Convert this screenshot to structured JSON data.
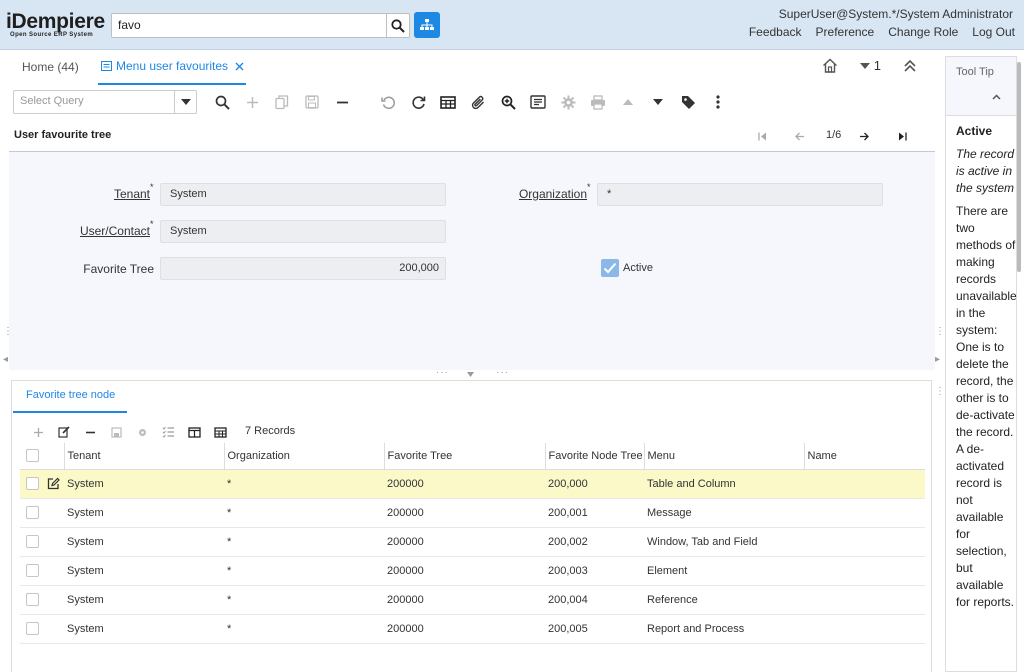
{
  "app": {
    "logo_main": "iDempiere",
    "logo_sub": "Open Source  ERP System"
  },
  "search": {
    "value": "favo"
  },
  "user": {
    "line": "SuperUser@System.*/System Administrator"
  },
  "header_links": [
    "Feedback",
    "Preference",
    "Change Role",
    "Log Out"
  ],
  "tabs": {
    "home": "Home (44)",
    "active": "Menu user favourites",
    "window_count": "1"
  },
  "toolbar": {
    "query_placeholder": "Select Query"
  },
  "record": {
    "title": "User favourite tree",
    "position": "1/6"
  },
  "form": {
    "tenant_label": "Tenant",
    "tenant_value": "System",
    "org_label": "Organization",
    "org_value": "*",
    "user_label": "User/Contact",
    "user_value": "System",
    "tree_label": "Favorite Tree",
    "tree_value": "200,000",
    "active_label": "Active",
    "active_checked": true
  },
  "detail": {
    "tab": "Favorite tree node",
    "record_count": "7 Records",
    "columns": [
      "Tenant",
      "Organization",
      "Favorite Tree",
      "Favorite Node Tree",
      "Menu",
      "Name"
    ],
    "rows": [
      [
        "System",
        "*",
        "200000",
        "200,000",
        "Table and Column",
        ""
      ],
      [
        "System",
        "*",
        "200000",
        "200,001",
        "Message",
        ""
      ],
      [
        "System",
        "*",
        "200000",
        "200,002",
        "Window, Tab and Field",
        ""
      ],
      [
        "System",
        "*",
        "200000",
        "200,003",
        "Element",
        ""
      ],
      [
        "System",
        "*",
        "200000",
        "200,004",
        "Reference",
        ""
      ],
      [
        "System",
        "*",
        "200000",
        "200,005",
        "Report and Process",
        ""
      ]
    ]
  },
  "tooltip": {
    "title": "Tool Tip",
    "heading": "Active",
    "description": "The record is active in the system",
    "help": "There are two methods of making records unavailable in the system: One is to delete the record, the other is to de-activate the record. A de-activated record is not available for selection, but available for reports."
  },
  "colors": {
    "accent": "#1e88e5",
    "header_bg": "#d8e6f4",
    "selected_row": "#fbf9c8"
  }
}
